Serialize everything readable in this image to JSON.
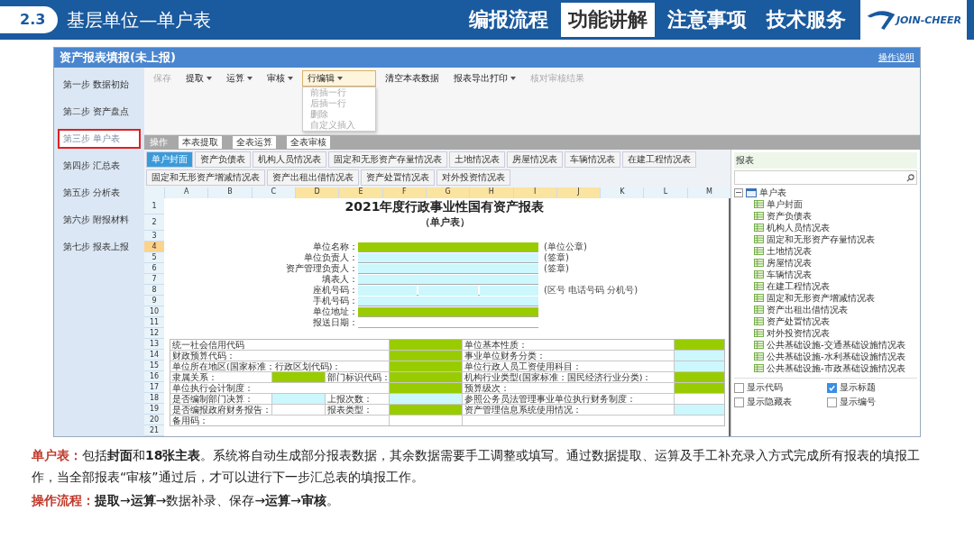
{
  "header": {
    "section_number": "2.3",
    "title": "基层单位—单户表",
    "logo_text": "JOIN-CHEER",
    "nav": [
      {
        "label": "编报流程",
        "selected": false
      },
      {
        "label": "功能讲解",
        "selected": true
      },
      {
        "label": "注意事项",
        "selected": false
      },
      {
        "label": "技术服务",
        "selected": false
      }
    ]
  },
  "app": {
    "title": "资产报表填报(未上报)",
    "help_link": "操作说明",
    "steps": [
      {
        "label": "第一步 数据初始",
        "selected": false
      },
      {
        "label": "第二步 资产盘点",
        "selected": false
      },
      {
        "label": "第三步 单户表",
        "selected": true
      },
      {
        "label": "第四步 汇总表",
        "selected": false
      },
      {
        "label": "第五步 分析表",
        "selected": false
      },
      {
        "label": "第六步 附报材料",
        "selected": false
      },
      {
        "label": "第七步 报表上报",
        "selected": false
      }
    ],
    "toolbar": [
      {
        "label": "保存",
        "dropdown": false,
        "disabled": true
      },
      {
        "label": "提取",
        "dropdown": true,
        "disabled": false
      },
      {
        "label": "运算",
        "dropdown": true,
        "disabled": false
      },
      {
        "label": "审核",
        "dropdown": true,
        "disabled": false
      },
      {
        "label": "行编辑",
        "dropdown": true,
        "disabled": false,
        "open": true
      },
      {
        "label": "清空本表数据",
        "dropdown": false,
        "disabled": false
      },
      {
        "label": "报表导出打印",
        "dropdown": true,
        "disabled": false
      },
      {
        "label": "核对审核结果",
        "dropdown": false,
        "disabled": true
      }
    ],
    "menu": [
      {
        "label": "前插一行",
        "disabled": true
      },
      {
        "label": "后插一行",
        "disabled": true
      },
      {
        "label": "删除",
        "disabled": true
      },
      {
        "label": "自定义插入",
        "disabled": true
      }
    ],
    "subtoolbar": [
      "操作",
      "本表提取",
      "全表运算",
      "全表审核"
    ],
    "sheet_tabs": [
      {
        "label": "单户封面",
        "selected": true
      },
      {
        "label": "资产负债表",
        "selected": false
      },
      {
        "label": "机构人员情况表",
        "selected": false
      },
      {
        "label": "固定和无形资产存量情况表",
        "selected": false
      },
      {
        "label": "土地情况表",
        "selected": false
      },
      {
        "label": "房屋情况表",
        "selected": false
      },
      {
        "label": "车辆情况表",
        "selected": false
      },
      {
        "label": "在建工程情况表",
        "selected": false
      },
      {
        "label": "固定和无形资产增减情况表",
        "selected": false
      },
      {
        "label": "资产出租出借情况表",
        "selected": false
      },
      {
        "label": "资产处置情况表",
        "selected": false
      },
      {
        "label": "对外投资情况表",
        "selected": false
      }
    ],
    "columns": [
      {
        "label": "A",
        "selected": false
      },
      {
        "label": "B",
        "selected": false
      },
      {
        "label": "C",
        "selected": false
      },
      {
        "label": "D",
        "selected": true
      },
      {
        "label": "E",
        "selected": true
      },
      {
        "label": "F",
        "selected": true
      },
      {
        "label": "G",
        "selected": true
      },
      {
        "label": "H",
        "selected": true
      },
      {
        "label": "I",
        "selected": true
      },
      {
        "label": "J",
        "selected": true
      },
      {
        "label": "K",
        "selected": false
      },
      {
        "label": "L",
        "selected": false
      },
      {
        "label": "M",
        "selected": false
      }
    ],
    "rows": [
      {
        "label": "1",
        "selected": false
      },
      {
        "label": "2",
        "selected": false
      },
      {
        "label": "3",
        "selected": false
      },
      {
        "label": "4",
        "selected": true
      },
      {
        "label": "5",
        "selected": false
      },
      {
        "label": "6",
        "selected": false
      },
      {
        "label": "7",
        "selected": false
      },
      {
        "label": "8",
        "selected": false
      },
      {
        "label": "9",
        "selected": false
      },
      {
        "label": "10",
        "selected": false
      },
      {
        "label": "11",
        "selected": false
      },
      {
        "label": "12",
        "selected": false
      },
      {
        "label": "13",
        "selected": false
      },
      {
        "label": "14",
        "selected": false
      },
      {
        "label": "15",
        "selected": false
      },
      {
        "label": "16",
        "selected": false
      },
      {
        "label": "17",
        "selected": false
      },
      {
        "label": "18",
        "selected": false
      },
      {
        "label": "19",
        "selected": false
      },
      {
        "label": "20",
        "selected": false
      },
      {
        "label": "21",
        "selected": false
      }
    ],
    "sheet": {
      "title": "2021年度行政事业性国有资产报表",
      "subtitle": "（单户表）",
      "form": [
        {
          "kind": "text",
          "label": "单位名称：",
          "color": "#99cc00",
          "note": "(单位公章)"
        },
        {
          "kind": "text",
          "label": "单位负责人：",
          "color": "#ccf7fc",
          "note": "(签章)"
        },
        {
          "kind": "text",
          "label": "资产管理负责人：",
          "color": "#ccf7fc",
          "note": "(签章)"
        },
        {
          "kind": "text",
          "label": "填表人：",
          "color": "#ccf7fc"
        },
        {
          "kind": "phone",
          "label": "座机号码：",
          "color": "#ccf7fc",
          "note": "(区号 电话号码 分机号)"
        },
        {
          "kind": "text",
          "label": "手机号码：",
          "color": "#ccf7fc"
        },
        {
          "kind": "text",
          "label": "单位地址：",
          "color": "#99cc00"
        },
        {
          "kind": "text",
          "label": "报送日期：",
          "color": "#ffffff"
        }
      ],
      "table": [
        {
          "kind": "wide",
          "label": "统一社会信用代码",
          "right_label": "单位基本性质：",
          "fields": [
            {
              "color": "#99cc00"
            },
            {
              "color": "#99cc00"
            }
          ]
        },
        {
          "kind": "wide",
          "label": "财政预算代码：",
          "right_label": "事业单位财务分类：",
          "fields": [
            {
              "color": "#99cc00"
            },
            {
              "color": "#ccf7fc"
            }
          ]
        },
        {
          "kind": "wide",
          "label": "单位所在地区(国家标准：行政区划代码)：",
          "right_label": "单位行政人员工资使用科目：",
          "fields": [
            {
              "color": "#99cc00"
            },
            {
              "color": "#ccf7fc"
            }
          ]
        },
        {
          "kind": "split",
          "label": "隶属关系：",
          "label2": "部门标识代码：",
          "right_label": "机构行业类型(国家标准：国民经济行业分类)：",
          "fields": [
            {
              "color": "#99cc00"
            },
            {
              "color": "#99cc00"
            },
            {
              "color": "#99cc00"
            }
          ]
        },
        {
          "kind": "wide",
          "label": "单位执行会计制度：",
          "right_label": "预算级次：",
          "fields": [
            {
              "color": "#99cc00"
            },
            {
              "color": "#99cc00"
            }
          ]
        },
        {
          "kind": "split",
          "label": "是否编制部门决算：",
          "label2": "上报次数：",
          "right_label": "参照公务员法管理事业单位执行财务制度：",
          "fields": [
            {
              "color": "#ccf7fc"
            },
            {
              "color": "#ccf7fc"
            },
            {
              "color": "#ffffff"
            }
          ]
        },
        {
          "kind": "split",
          "label": "是否编报政府财务报告：",
          "label2": "报表类型：",
          "right_label": "资产管理信息系统使用情况：",
          "fields": [
            {
              "color": "#ffffff"
            },
            {
              "color": "#99cc00"
            },
            {
              "color": "#ccf7fc"
            }
          ]
        },
        {
          "kind": "wide",
          "label": "备用码：",
          "fields": [
            {
              "color": "#ffffff"
            },
            {
              "color": "#ffffff"
            }
          ]
        }
      ]
    },
    "panel": {
      "title": "报表",
      "tree": {
        "label": "单户表",
        "expanded": true,
        "children": [
          {
            "label": "单户封面"
          },
          {
            "label": "资产负债表"
          },
          {
            "label": "机构人员情况表"
          },
          {
            "label": "固定和无形资产存量情况表"
          },
          {
            "label": "土地情况表"
          },
          {
            "label": "房屋情况表"
          },
          {
            "label": "车辆情况表"
          },
          {
            "label": "在建工程情况表"
          },
          {
            "label": "固定和无形资产增减情况表"
          },
          {
            "label": "资产出租出借情况表"
          },
          {
            "label": "资产处置情况表"
          },
          {
            "label": "对外投资情况表"
          },
          {
            "label": "公共基础设施-交通基础设施情况表"
          },
          {
            "label": "公共基础设施-水利基础设施情况表"
          },
          {
            "label": "公共基础设施-市政基础设施情况表"
          }
        ]
      },
      "options": [
        {
          "label": "显示代码",
          "checked": false
        },
        {
          "label": "显示标题",
          "checked": true
        },
        {
          "label": "显示隐藏表",
          "checked": false
        },
        {
          "label": "显示编号",
          "checked": false
        }
      ]
    }
  },
  "description": {
    "label": "单户表：",
    "text": "包括**封面**和**18张主表**。系统将自动生成部分报表数据，其余数据需要手工调整或填写。通过数据提取、运算及手工补充录入方式完成所有报表的填报工作，当全部报表“审核”通过后，才可以进行下一步汇总表的填报工作。"
  },
  "flow": {
    "label": "操作流程：",
    "text": "**提取**→**运算**→数据补录、保存→**运算**→**审核**。"
  }
}
